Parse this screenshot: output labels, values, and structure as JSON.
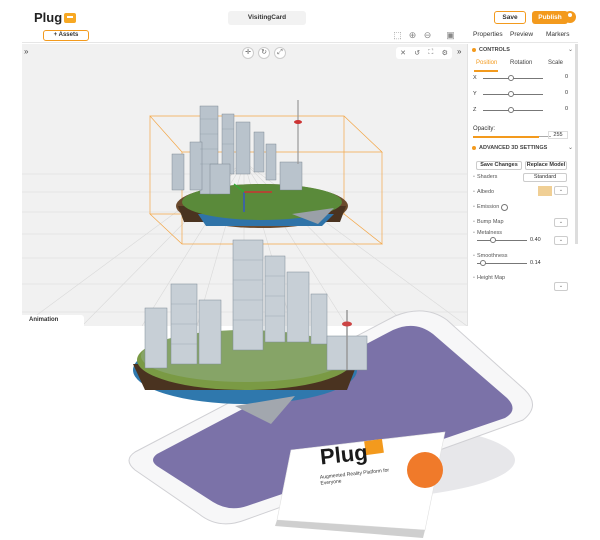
{
  "app": {
    "logo": "Plug",
    "title": "VisitingCard"
  },
  "header": {
    "save_label": "Save",
    "publish_label": "Publish"
  },
  "toolbar": {
    "assets_label": "+ Assets"
  },
  "panel_tabs": [
    "Properties",
    "Preview",
    "Markers"
  ],
  "controls": {
    "heading": "CONTROLS",
    "tabs": [
      "Position",
      "Rotation",
      "Scale"
    ],
    "active_tab": "Position",
    "axes": [
      {
        "label": "X",
        "value": "0"
      },
      {
        "label": "Y",
        "value": "0"
      },
      {
        "label": "Z",
        "value": "0"
      }
    ],
    "opacity_label": "Opacity:",
    "opacity_value": "255"
  },
  "advanced": {
    "heading": "ADVANCED 3D SETTINGS",
    "save_changes": "Save Changes",
    "replace_model": "Replace Model",
    "shaders_label": "Shaders",
    "shaders_value": "Standard",
    "albedo_label": "Albedo",
    "albedo_color": "#f0cf95",
    "emission_label": "Emission",
    "bump_label": "Bump Map",
    "metalness_label": "Metalness",
    "metalness_value": "0.40",
    "smoothness_label": "Smoothness",
    "smoothness_value": "0.14",
    "height_label": "Height Map"
  },
  "viewport": {
    "animation_label": "Animation"
  },
  "card": {
    "brand": "Plug",
    "tagline": "Augmented Reality Platform for Everyone"
  },
  "colors": {
    "accent": "#f39a1d",
    "viewport_bg": "#f1f1f1"
  }
}
